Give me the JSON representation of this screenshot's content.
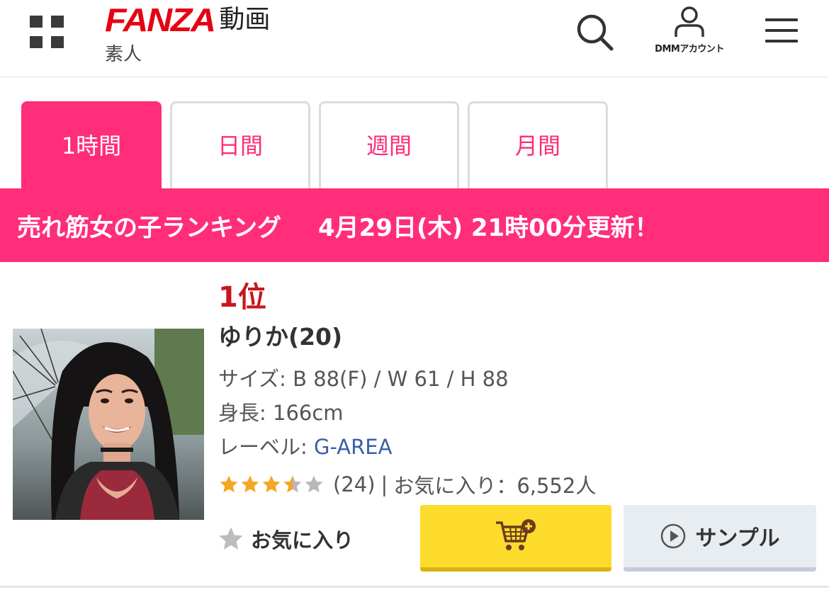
{
  "header": {
    "logo_text": "FANZA",
    "logo_suffix": "動画",
    "subtitle": "素人",
    "account_label": "DMMアカウント",
    "icons": {
      "grid": "grid-menu-icon",
      "search": "search-icon",
      "account": "user-icon",
      "menu": "hamburger-menu-icon"
    }
  },
  "tabs": [
    {
      "label": "1時間",
      "active": true
    },
    {
      "label": "日間",
      "active": false
    },
    {
      "label": "週間",
      "active": false
    },
    {
      "label": "月間",
      "active": false
    }
  ],
  "banner": {
    "title": "売れ筋女の子ランキング",
    "updated": "4月29日(木) 21時00分更新！"
  },
  "item": {
    "rank": "1位",
    "name": "ゆりか(20)",
    "size": "サイズ: B 88(F) / W 61 / H 88",
    "height": "身長: 166cm",
    "label_prefix": "レーベル: ",
    "label_value": "G-AREA",
    "rating_value": 3.5,
    "rating_max": 5,
    "review_count": "(24)",
    "separator": "|",
    "favorites": "お気に入り：6,552人",
    "favorite_button": "お気に入り",
    "sample_button": "サンプル"
  },
  "colors": {
    "accent_pink": "#ff2d7a",
    "brand_red": "#e60012",
    "rank_red": "#c8161d",
    "link_blue": "#3a5fa8",
    "star_gold": "#f5a623",
    "cart_yellow": "#fddb2c"
  }
}
